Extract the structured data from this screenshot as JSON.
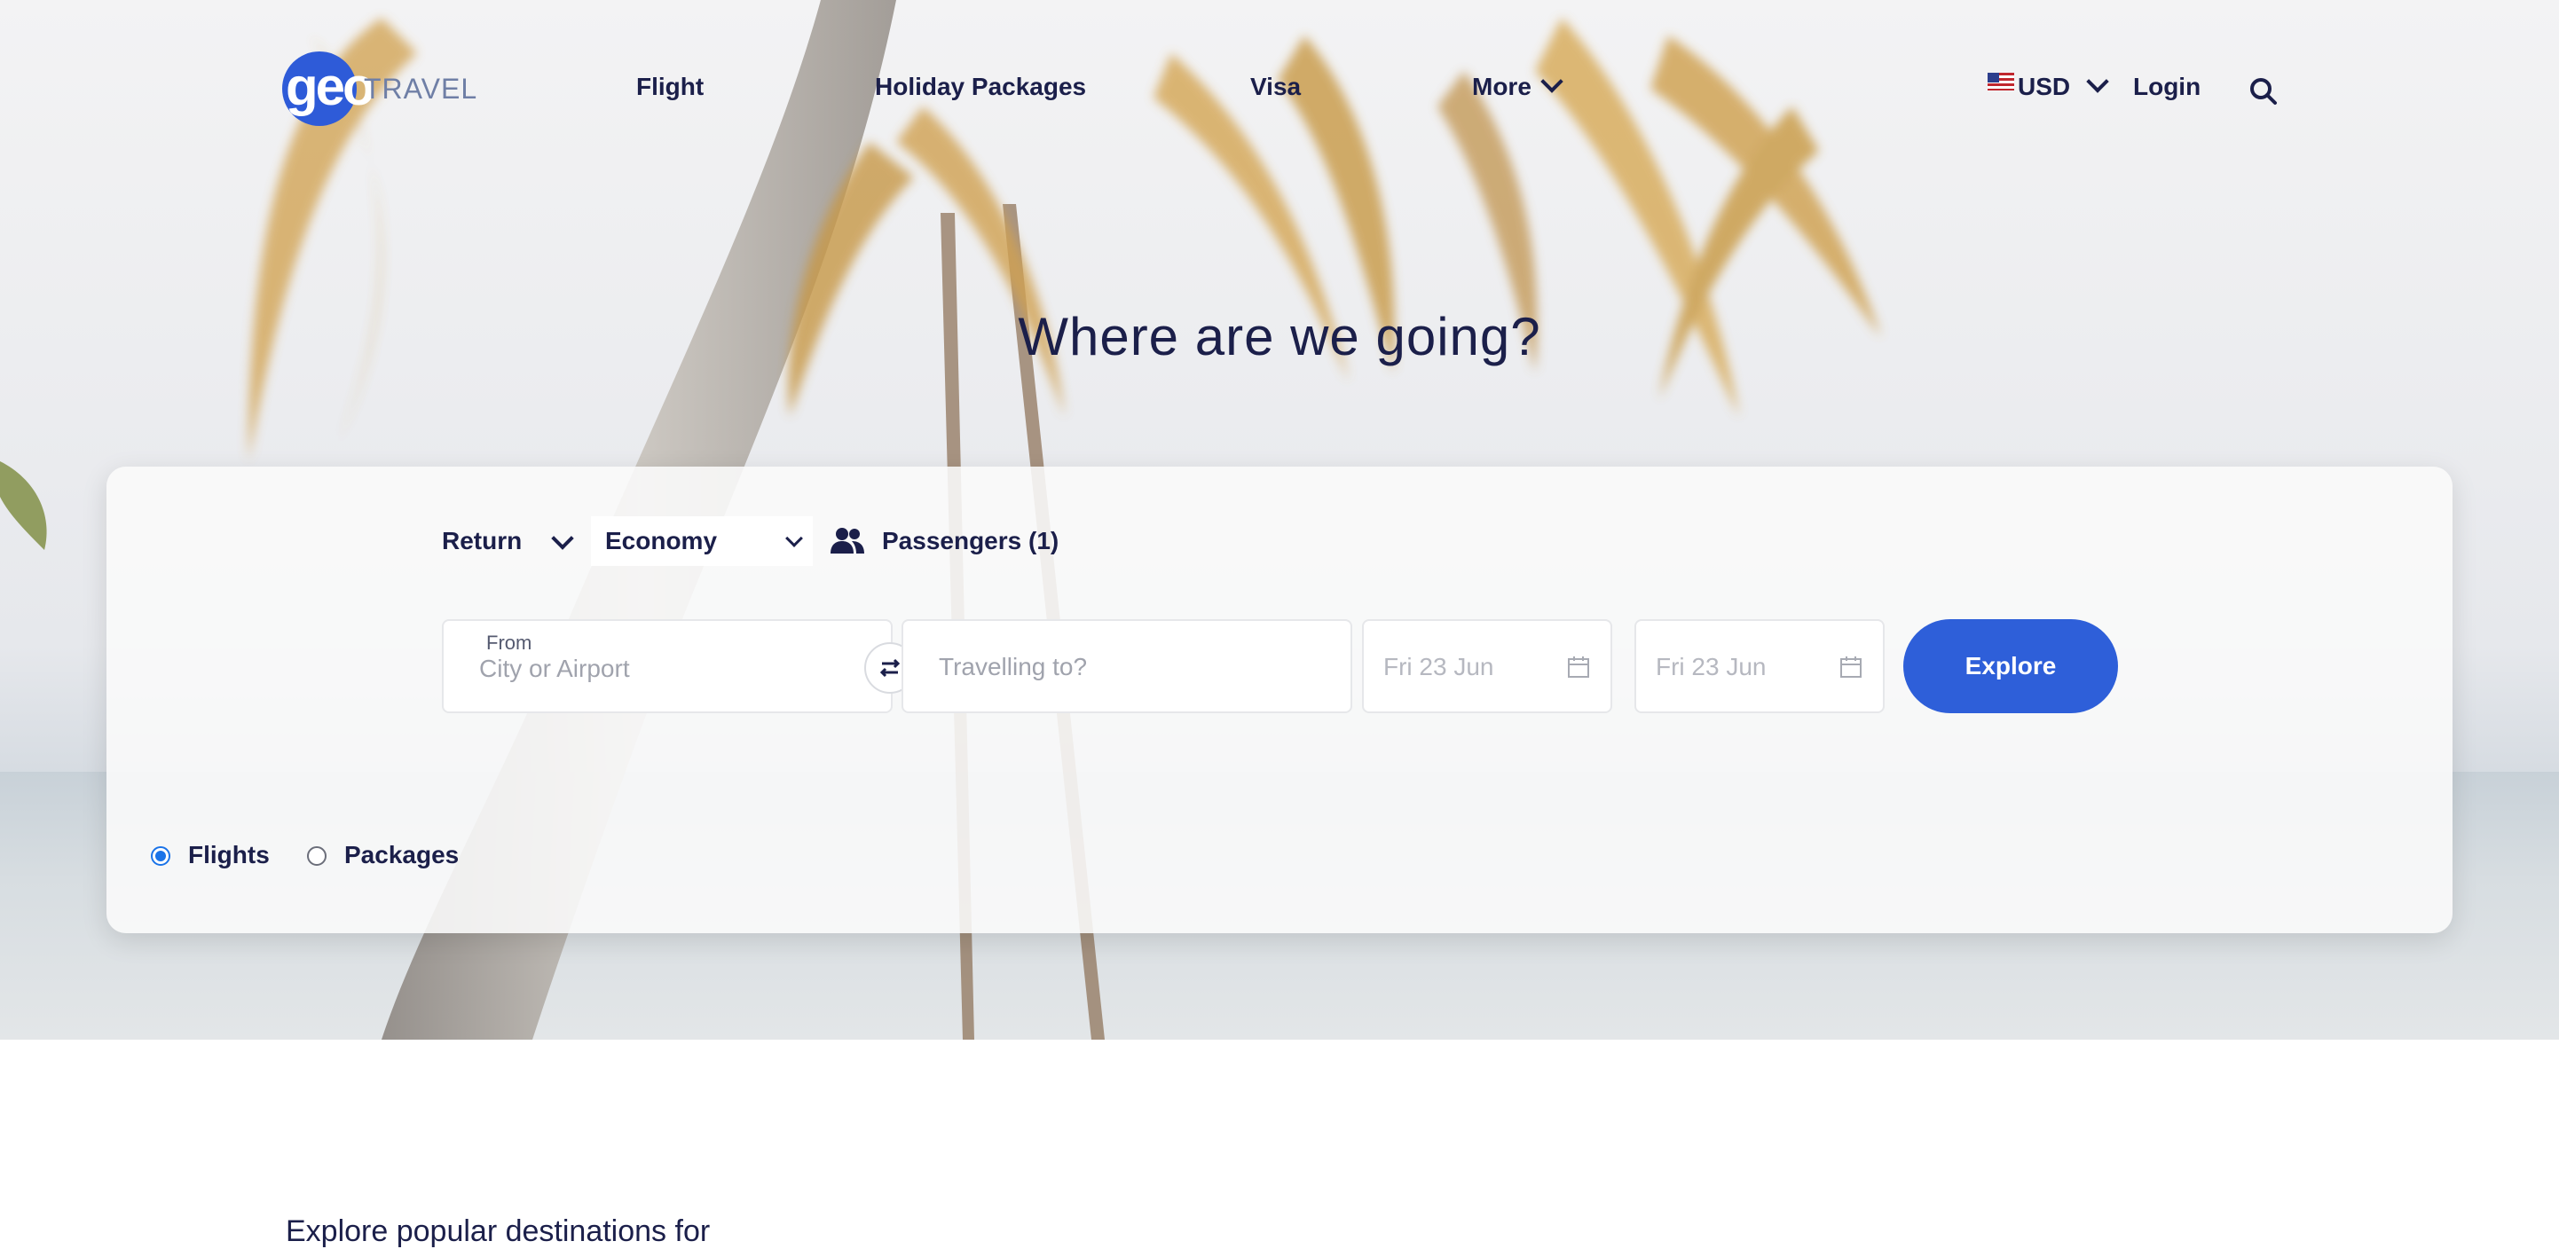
{
  "brand": {
    "logo_geo": "geo",
    "logo_travel": "TRAVEL"
  },
  "nav": {
    "items": [
      "Flight",
      "Holiday Packages",
      "Visa",
      "More"
    ],
    "currency": "USD",
    "login": "Login",
    "icons": {
      "flag": "us-flag-icon",
      "search": "search-icon"
    }
  },
  "hero": {
    "headline": "Where are we going?"
  },
  "search": {
    "trip_type": "Return",
    "cabin_class": "Economy",
    "passengers": "Passengers (1)",
    "from_label": "From",
    "from_placeholder": "City or Airport",
    "to_placeholder": "Travelling to?",
    "depart_date": "Fri 23 Jun",
    "return_date": "Fri 23 Jun",
    "explore_label": "Explore",
    "mode_options": [
      "Flights",
      "Packages"
    ],
    "mode_selected": "Flights"
  },
  "section": {
    "heading_partial": "Explore popular destinations for"
  },
  "colors": {
    "accent": "#2e5fd9",
    "text": "#1b1f4a",
    "radio": "#1a73e8"
  }
}
